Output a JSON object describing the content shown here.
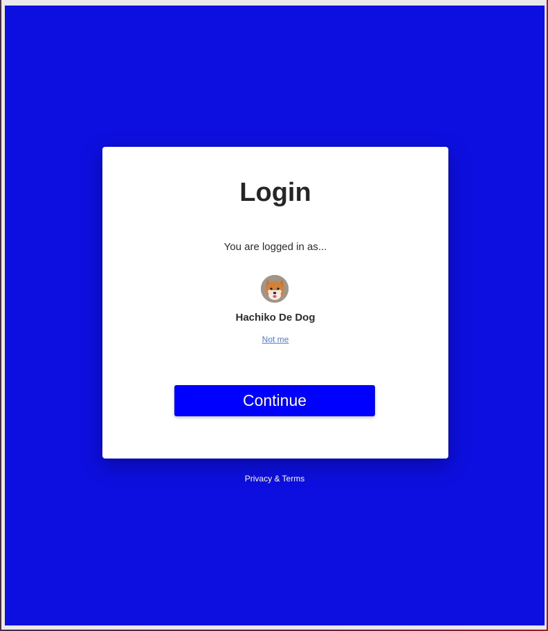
{
  "login": {
    "title": "Login",
    "subtitle": "You are logged in as...",
    "user": {
      "name": "Hachiko De Dog",
      "avatar_icon": "shiba-dog-avatar"
    },
    "not_me_link": "Not me",
    "continue_button": "Continue"
  },
  "footer": {
    "privacy_terms_link": "Privacy & Terms"
  },
  "colors": {
    "background": "#0d0fe0",
    "card": "#ffffff",
    "button": "#0000ff",
    "link": "#4a7be0",
    "text": "#262626"
  }
}
